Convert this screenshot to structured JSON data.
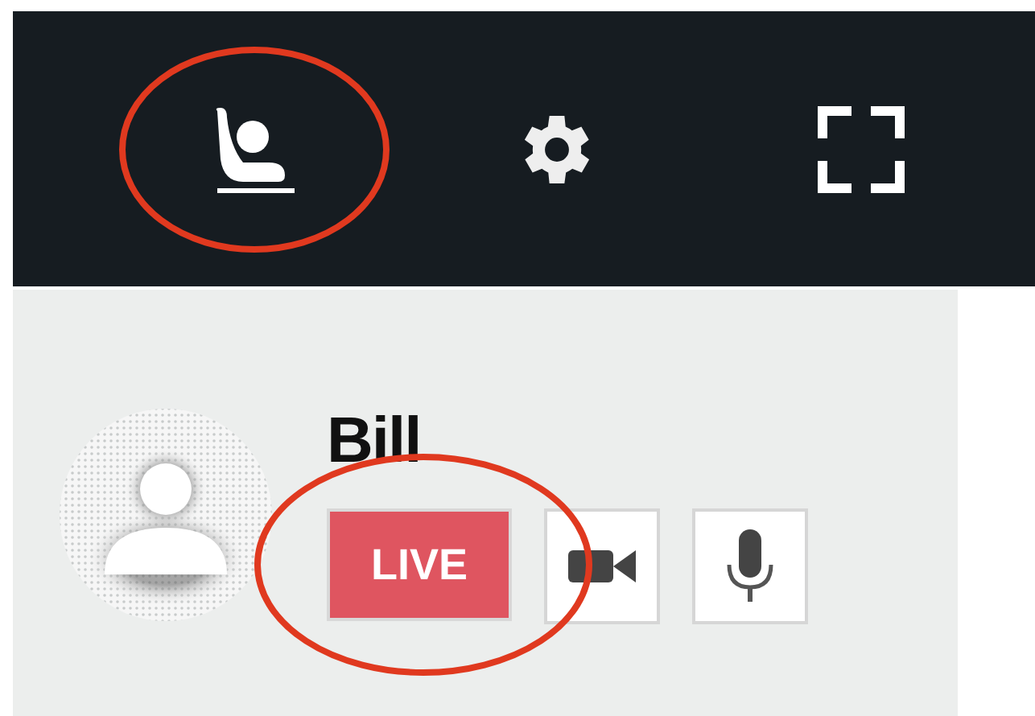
{
  "toolbar": [
    {
      "kind": "seat",
      "highlighted": true
    },
    {
      "kind": "settings",
      "highlighted": false
    },
    {
      "kind": "fullscreen",
      "highlighted": false
    }
  ],
  "participant": {
    "name": "Bill",
    "live": {
      "label": "LIVE",
      "highlighted": true
    },
    "media": [
      {
        "kind": "camera"
      },
      {
        "kind": "microphone"
      }
    ]
  }
}
